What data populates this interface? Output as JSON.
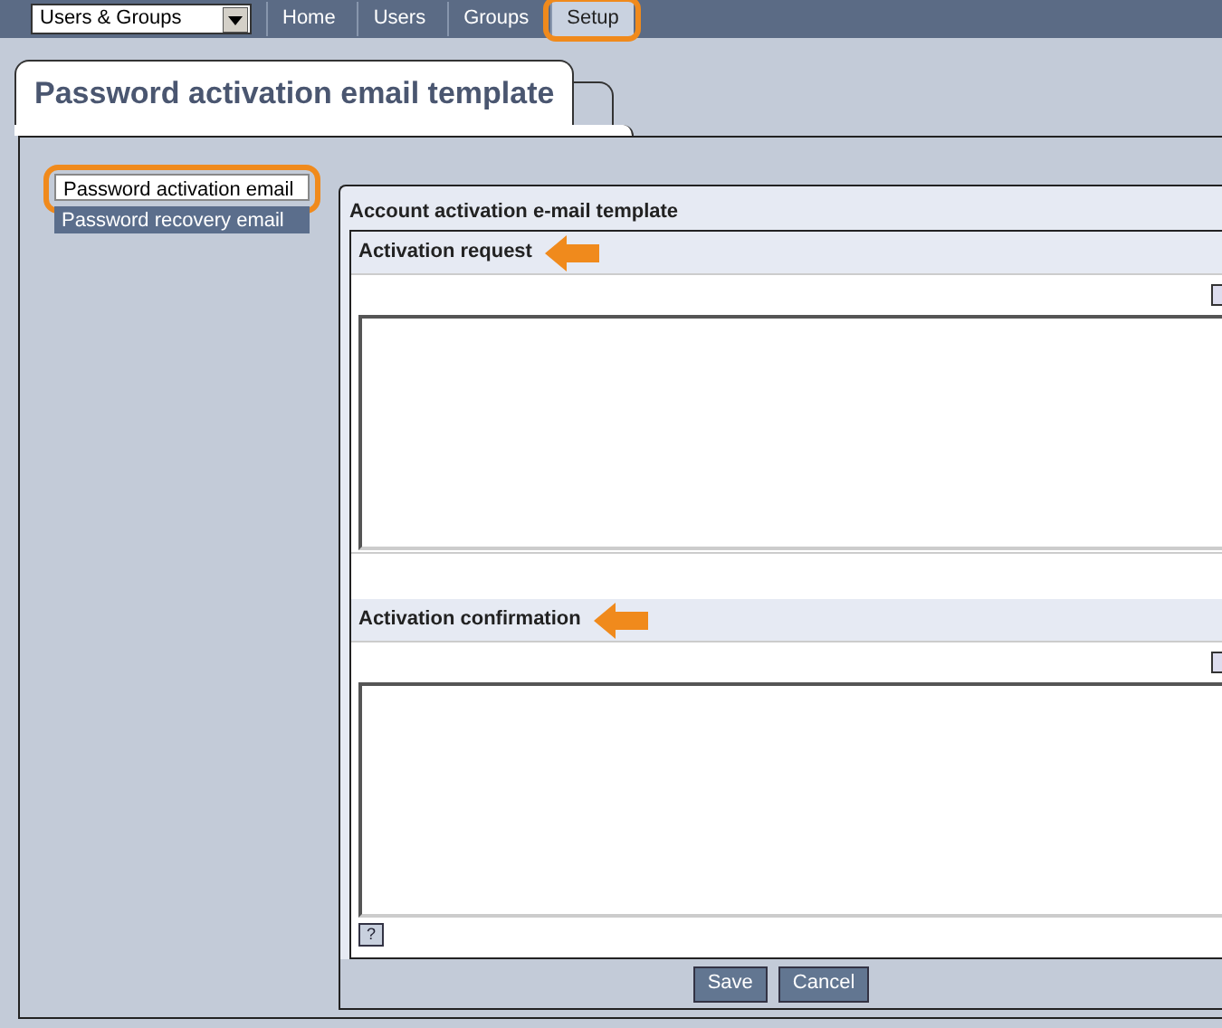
{
  "module_select": {
    "value": "Users & Groups"
  },
  "nav_tabs": [
    {
      "label": "Home",
      "selected": false,
      "highlighted": false
    },
    {
      "label": "Users",
      "selected": false,
      "highlighted": false
    },
    {
      "label": "Groups",
      "selected": false,
      "highlighted": false
    },
    {
      "label": "Setup",
      "selected": true,
      "highlighted": true
    }
  ],
  "page_title": "Password activation email template",
  "sidebar": {
    "items": [
      {
        "label": "Password activation email",
        "selected": true,
        "highlighted": true
      },
      {
        "label": "Password recovery email",
        "selected": false,
        "highlighted": false
      }
    ]
  },
  "panel": {
    "title": "Account activation e-mail template",
    "sections": [
      {
        "title": "Activation request",
        "arrow": true,
        "help": false
      },
      {
        "title": "Activation confirmation",
        "arrow": true,
        "help": true
      }
    ],
    "help_label": "?",
    "buttons": [
      "Save",
      "Cancel"
    ]
  }
}
